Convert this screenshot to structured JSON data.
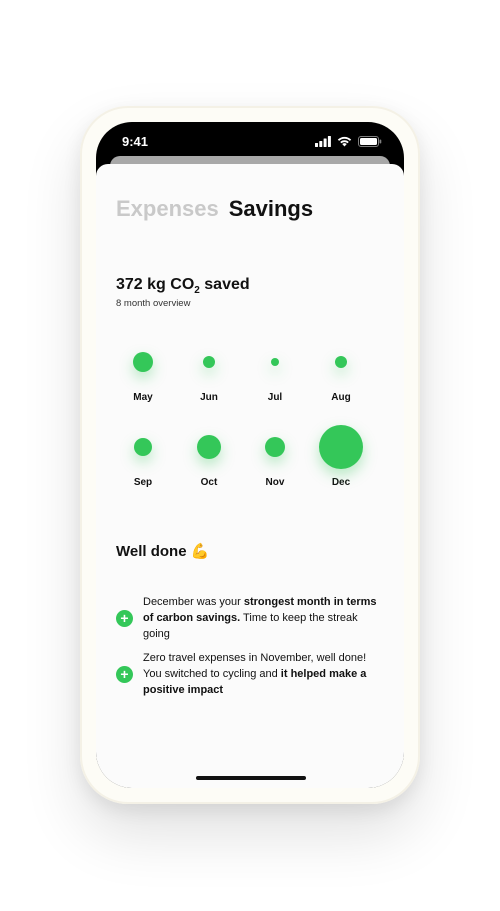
{
  "status_bar": {
    "time": "9:41"
  },
  "tabs": [
    {
      "label": "Expenses",
      "active": false
    },
    {
      "label": "Savings",
      "active": true
    }
  ],
  "summary": {
    "title_prefix": "372 kg CO",
    "title_sub": "2",
    "title_suffix": " saved",
    "subtitle": "8 month overview"
  },
  "months": [
    {
      "label": "May",
      "relative_size": 0.45
    },
    {
      "label": "Jun",
      "relative_size": 0.27
    },
    {
      "label": "Jul",
      "relative_size": 0.18
    },
    {
      "label": "Aug",
      "relative_size": 0.27
    },
    {
      "label": "Sep",
      "relative_size": 0.41
    },
    {
      "label": "Oct",
      "relative_size": 0.55
    },
    {
      "label": "Nov",
      "relative_size": 0.45
    },
    {
      "label": "Dec",
      "relative_size": 1.0
    }
  ],
  "well_done": {
    "title": "Well done",
    "emoji": "💪"
  },
  "insights": [
    {
      "parts": [
        "December was your ",
        "strongest month in terms of carbon savings.",
        " Time to keep the streak going"
      ]
    },
    {
      "parts": [
        "Zero travel expenses in November, well done! You switched to cycling and ",
        "it helped make a positive impact",
        ""
      ]
    }
  ],
  "colors": {
    "accent": "#34c759",
    "text": "#111111",
    "inactive_tab": "#c9c9c9"
  }
}
